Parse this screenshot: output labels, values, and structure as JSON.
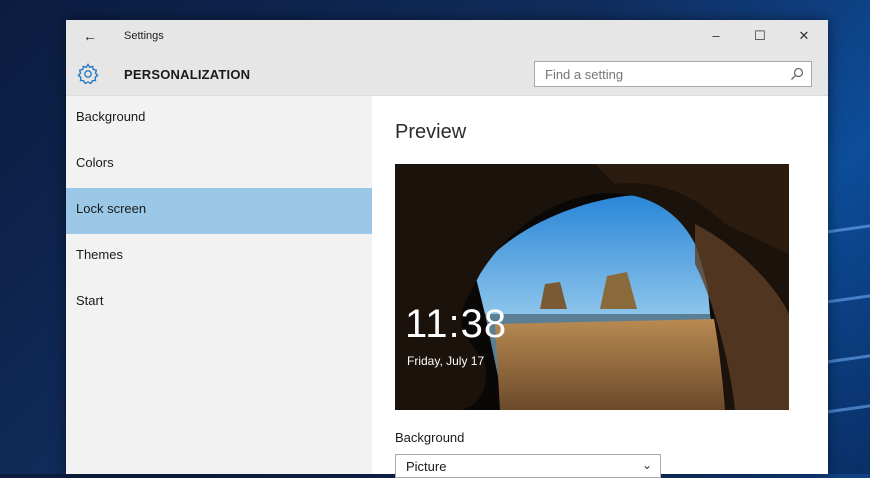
{
  "window": {
    "title": "Settings",
    "back_icon": "back-arrow-icon",
    "controls": {
      "minimize": "–",
      "maximize": "☐",
      "close": "✕"
    }
  },
  "header": {
    "icon": "gear-icon",
    "title": "PERSONALIZATION",
    "search": {
      "placeholder": "Find a setting",
      "value": ""
    }
  },
  "sidebar": {
    "items": [
      {
        "label": "Background",
        "selected": false
      },
      {
        "label": "Colors",
        "selected": false
      },
      {
        "label": "Lock screen",
        "selected": true
      },
      {
        "label": "Themes",
        "selected": false
      },
      {
        "label": "Start",
        "selected": false
      }
    ]
  },
  "main": {
    "preview_title": "Preview",
    "preview": {
      "time": "11:38",
      "date": "Friday, July 17"
    },
    "background_label": "Background",
    "background_select": {
      "value": "Picture"
    }
  },
  "colors": {
    "accent": "#9bc8e6",
    "titlebar": "#e6e6e6",
    "sidebar": "#f2f2f2"
  }
}
